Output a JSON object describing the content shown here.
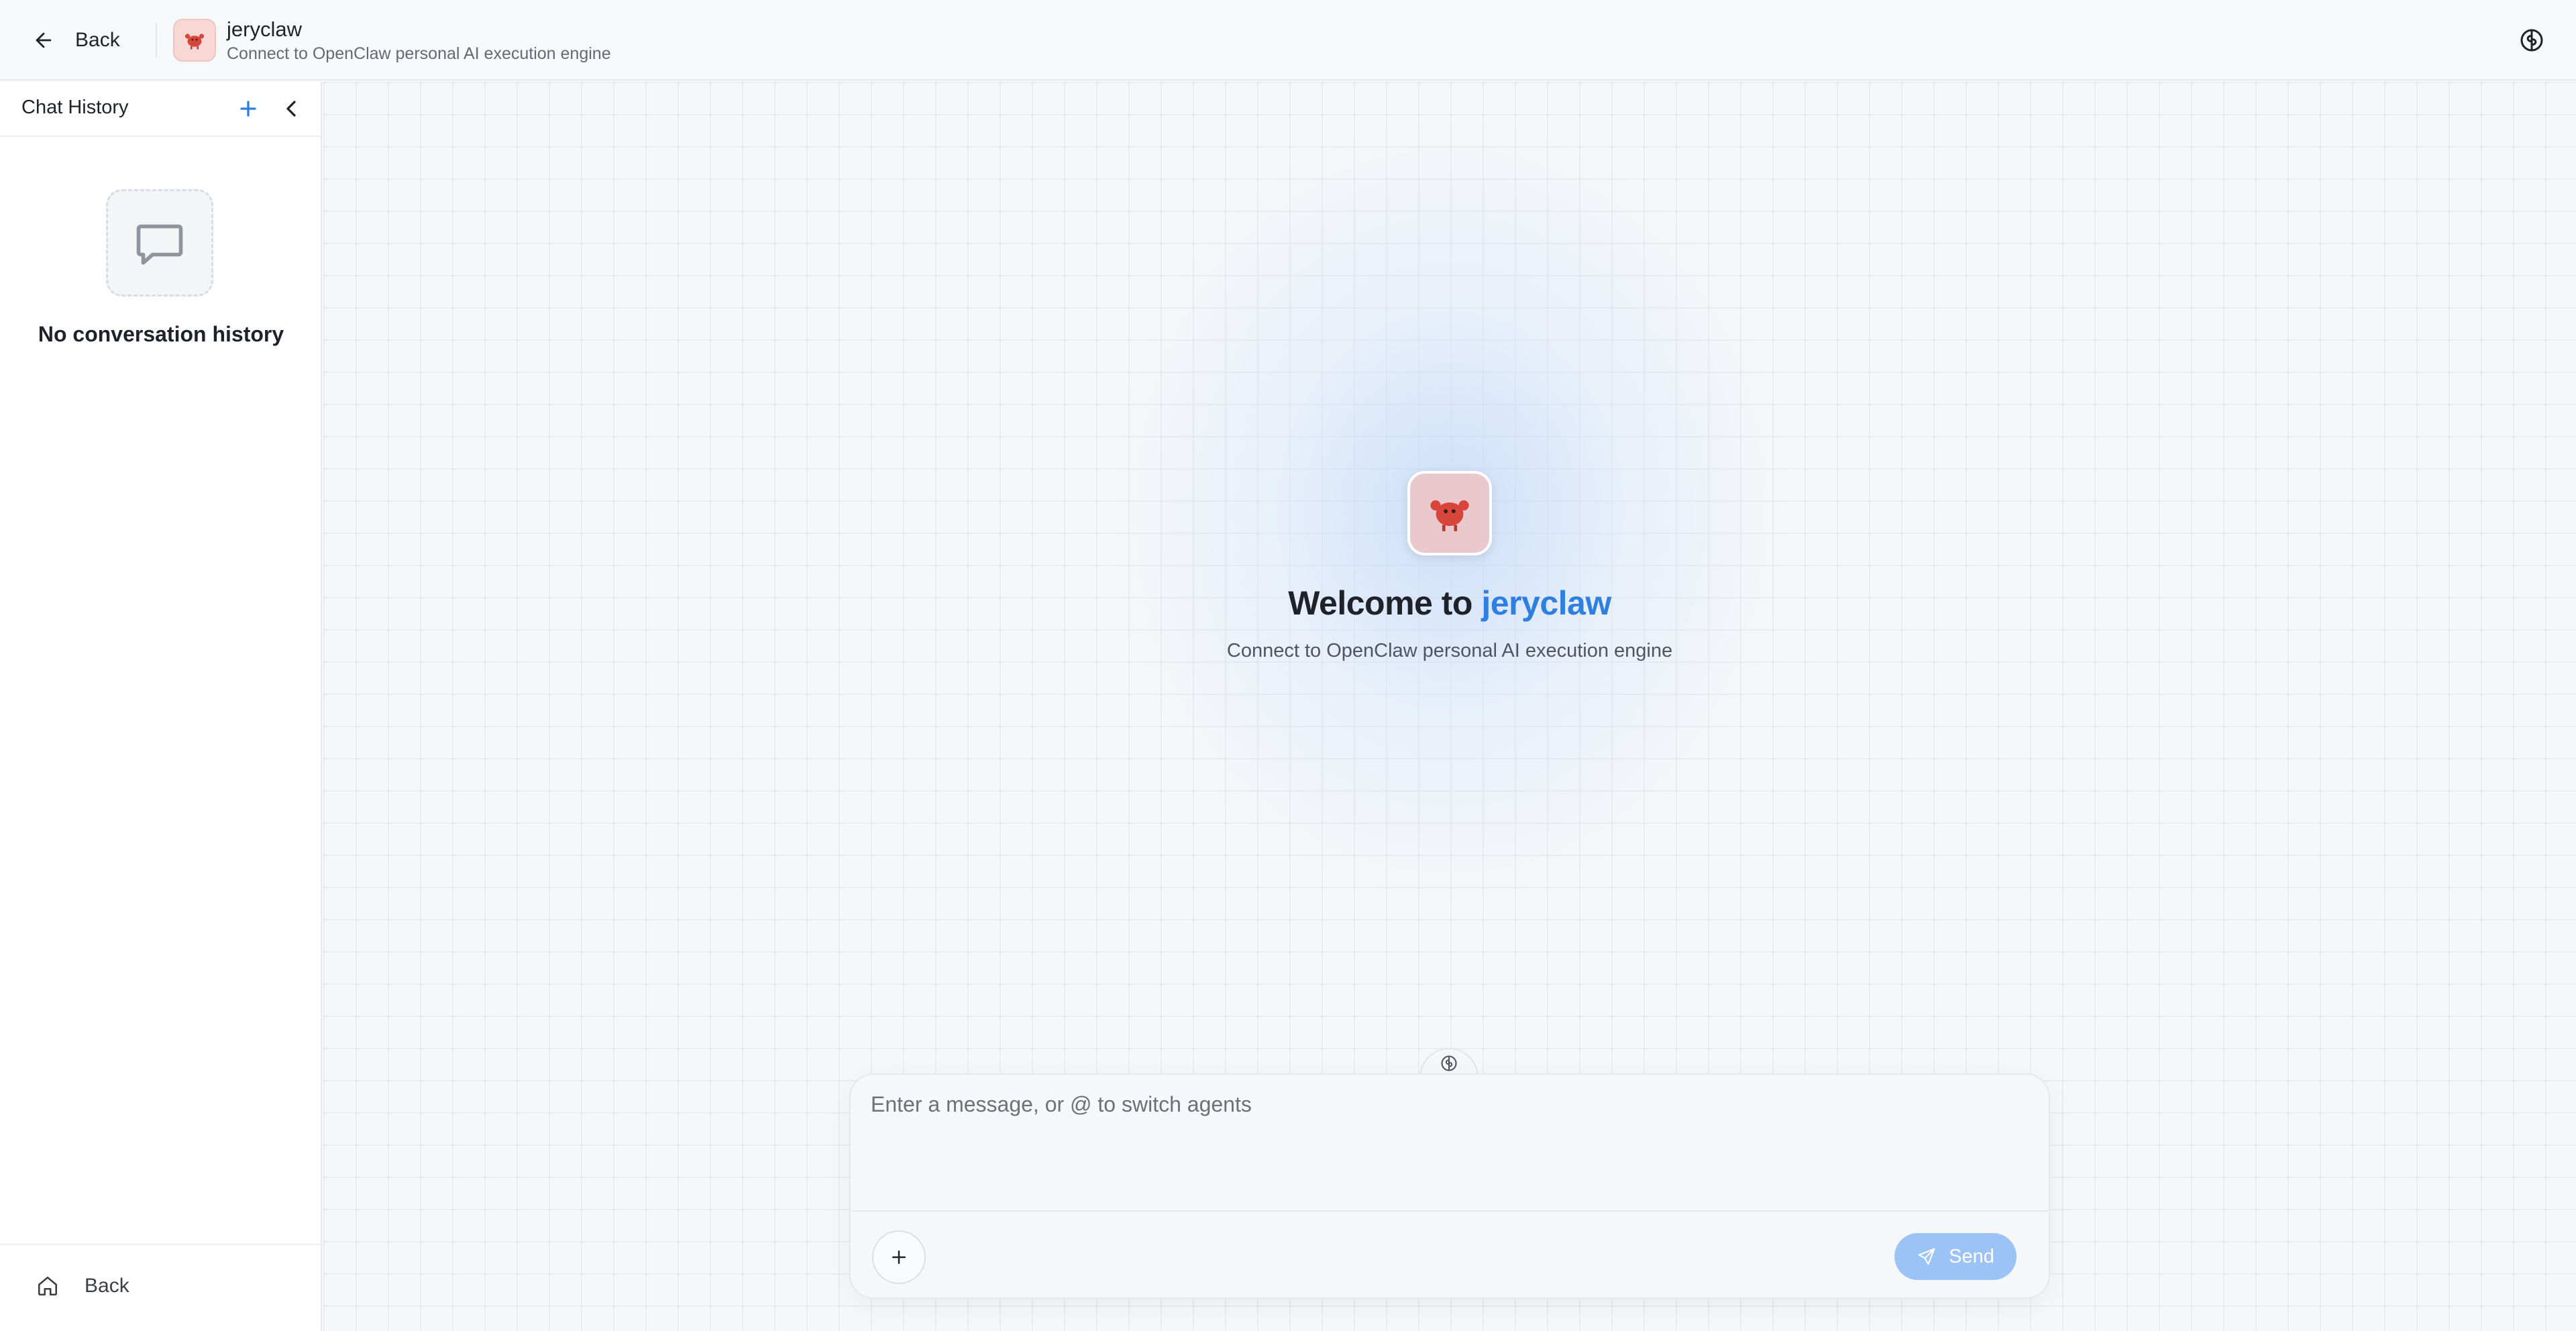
{
  "header": {
    "back_label": "Back",
    "agent_name": "jeryclaw",
    "agent_description": "Connect to OpenClaw personal AI execution engine",
    "right_icon": "brain-icon"
  },
  "sidebar": {
    "title": "Chat History",
    "new_chat_icon": "plus-icon",
    "collapse_icon": "chevron-left-icon",
    "empty_icon": "message-square-icon",
    "empty_text": "No conversation history",
    "footer_back_label": "Back",
    "footer_icon": "home-icon"
  },
  "main": {
    "welcome_prefix": "Welcome to",
    "welcome_name": "jeryclaw",
    "welcome_subtitle": "Connect to OpenClaw personal AI execution engine"
  },
  "composer": {
    "placeholder": "Enter a message, or @ to switch agents",
    "value": "",
    "send_label": "Send",
    "attach_icon": "plus-icon",
    "mode_icon": "brain-icon"
  },
  "colors": {
    "accent": "#2f7fe0",
    "send_button": "#9cc3f5",
    "avatar_bg": "#f7d8d5"
  }
}
